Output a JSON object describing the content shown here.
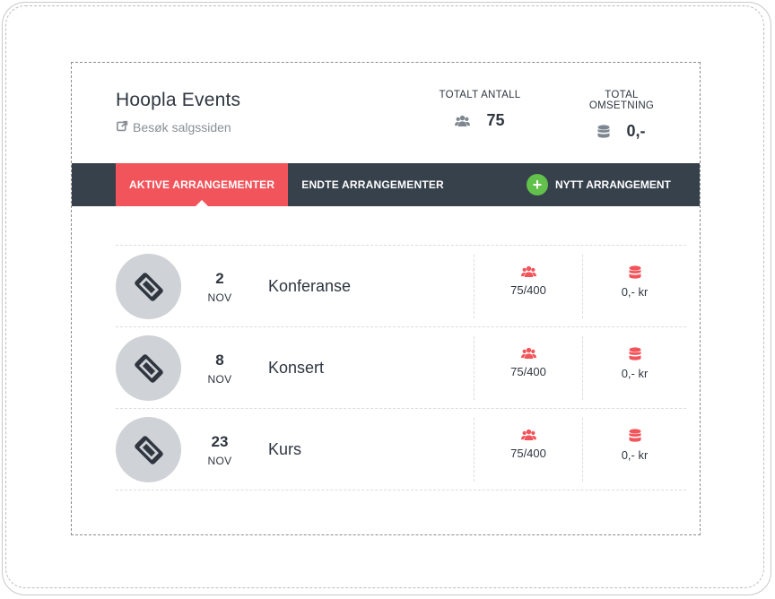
{
  "app": {
    "title": "Hoopla Events",
    "visit_link": "Besøk salgssiden"
  },
  "stats": {
    "total_count_label": "TOTALT ANTALL",
    "total_count_value": "75",
    "total_revenue_label": "TOTAL OMSETNING",
    "total_revenue_value": "0,-"
  },
  "nav": {
    "tabs": [
      {
        "label": "AKTIVE ARRANGEMENTER",
        "active": true
      },
      {
        "label": "ENDTE ARRANGEMENTER",
        "active": false
      }
    ],
    "new_event_label": "NYTT ARRANGEMENT"
  },
  "events": [
    {
      "day": "2",
      "month": "NOV",
      "name": "Konferanse",
      "count": "75/400",
      "revenue": "0,- kr"
    },
    {
      "day": "8",
      "month": "NOV",
      "name": "Konsert",
      "count": "75/400",
      "revenue": "0,- kr"
    },
    {
      "day": "23",
      "month": "NOV",
      "name": "Kurs",
      "count": "75/400",
      "revenue": "0,- kr"
    }
  ],
  "colors": {
    "accent": "#f2545b",
    "nav_background": "#37414c",
    "add_button": "#61c14b",
    "avatar_background": "#cfd2d6"
  },
  "icons": {
    "visit_link": "external-link-icon",
    "total_count": "users-icon",
    "total_revenue": "database-icon",
    "new_event": "plus-icon",
    "event_avatar": "ticket-icon",
    "event_count": "users-icon",
    "event_revenue": "database-icon"
  }
}
